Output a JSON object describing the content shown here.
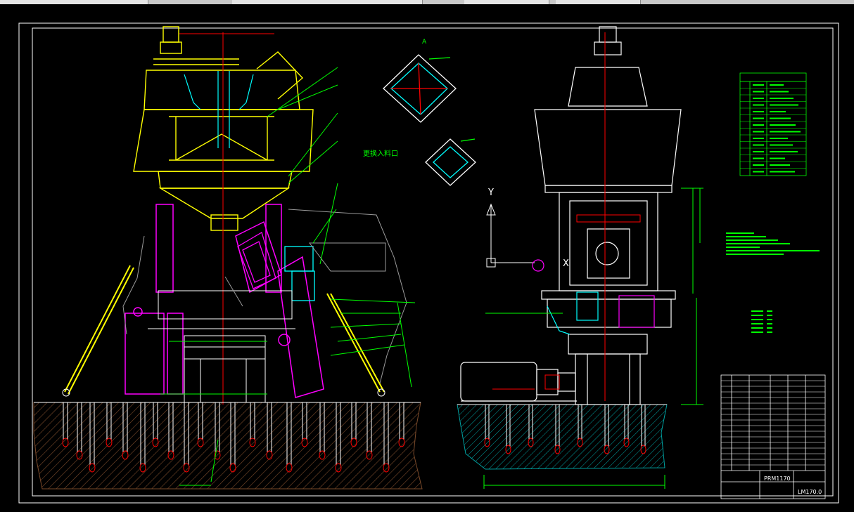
{
  "drawing": {
    "label_feed_inlet": "更换入料口",
    "view_a_label": "A",
    "axis_y_label": "Y",
    "axis_x_label": "X",
    "title_block_name": "PRM1170",
    "drawing_number": "LM170.0"
  },
  "colors": {
    "background": "#000000",
    "frame": "#ffffff",
    "yellow": "#ffff00",
    "magenta": "#ff00ff",
    "cyan": "#00ffff",
    "green": "#00ff00",
    "red": "#ff0000",
    "gray": "#9a9a9a",
    "ground": "#7a4a2a"
  }
}
